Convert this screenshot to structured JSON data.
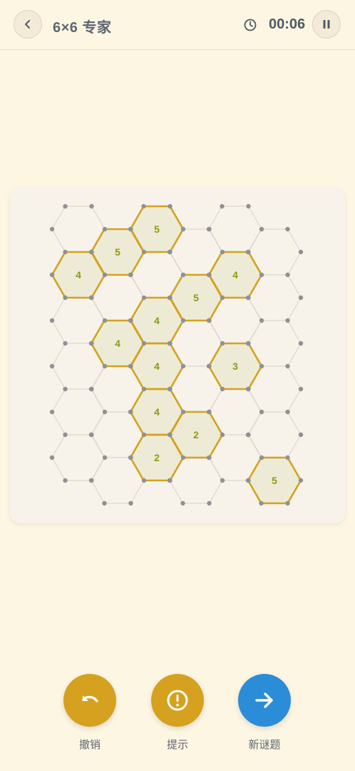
{
  "header": {
    "title": "6×6 专家",
    "timer": "00:06"
  },
  "colors": {
    "background": "#FDF6E3",
    "accent_gold": "#D5A11E",
    "accent_blue": "#2B8CD8",
    "cell_fill": "#EDEBD6",
    "clue_text": "#8E9A12",
    "dot": "#8E9297"
  },
  "board": {
    "cols": 6,
    "rows": 6,
    "clues": [
      {
        "col": 1,
        "row": 0,
        "value": "5"
      },
      {
        "col": 2,
        "row": 0,
        "value": "5"
      },
      {
        "col": 0,
        "row": 1,
        "value": "4"
      },
      {
        "col": 4,
        "row": 1,
        "value": "4"
      },
      {
        "col": 3,
        "row": 1,
        "value": "5"
      },
      {
        "col": 2,
        "row": 2,
        "value": "4"
      },
      {
        "col": 1,
        "row": 2,
        "value": "4"
      },
      {
        "col": 2,
        "row": 3,
        "value": "4"
      },
      {
        "col": 4,
        "row": 3,
        "value": "3"
      },
      {
        "col": 2,
        "row": 4,
        "value": "4"
      },
      {
        "col": 3,
        "row": 4,
        "value": "2"
      },
      {
        "col": 2,
        "row": 5,
        "value": "2"
      },
      {
        "col": 5,
        "row": 5,
        "value": "5"
      }
    ]
  },
  "controls": {
    "undo_label": "撤销",
    "hint_label": "提示",
    "next_label": "新谜题"
  },
  "icons": {
    "back": "chevron-left-icon",
    "clock": "clock-icon",
    "pause": "pause-icon",
    "undo": "undo-icon",
    "hint": "exclamation-circle-icon",
    "next": "arrow-right-icon"
  }
}
